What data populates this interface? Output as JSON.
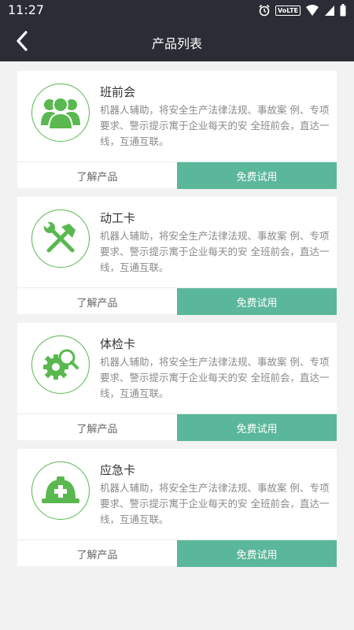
{
  "status_bar": {
    "time": "11:27",
    "icons": [
      "alarm-icon",
      "volte-badge",
      "wifi-icon",
      "signal-icon",
      "battery-icon"
    ],
    "volte_label": "VoLTE"
  },
  "header": {
    "title": "产品列表",
    "back_icon": "back-arrow-icon",
    "background": "#2a2d35"
  },
  "colors": {
    "accent_green": "#59b84f",
    "trial_button": "#5bb79a"
  },
  "products": [
    {
      "title": "班前会",
      "icon": "group-people-icon",
      "description": "机器人辅助，将安全生产法律法规、事故案 例、专项要求、警示提示寓于企业每天的安 全班前会，直达一线，互通互联。",
      "learn_label": "了解产品",
      "trial_label": "免费试用"
    },
    {
      "title": "动工卡",
      "icon": "tools-wrench-hammer-icon",
      "description": "机器人辅助，将安全生产法律法规、事故案 例、专项要求、警示提示寓于企业每天的安 全班前会，直达一线，互通互联。",
      "learn_label": "了解产品",
      "trial_label": "免费试用"
    },
    {
      "title": "体检卡",
      "icon": "gear-magnifier-icon",
      "description": "机器人辅助，将安全生产法律法规、事故案 例、专项要求、警示提示寓于企业每天的安 全班前会，直达一线，互通互联。",
      "learn_label": "了解产品",
      "trial_label": "免费试用"
    },
    {
      "title": "应急卡",
      "icon": "helmet-cross-icon",
      "description": "机器人辅助，将安全生产法律法规、事故案 例、专项要求、警示提示寓于企业每天的安 全班前会，直达一线，互通互联。",
      "learn_label": "了解产品",
      "trial_label": "免费试用"
    }
  ]
}
